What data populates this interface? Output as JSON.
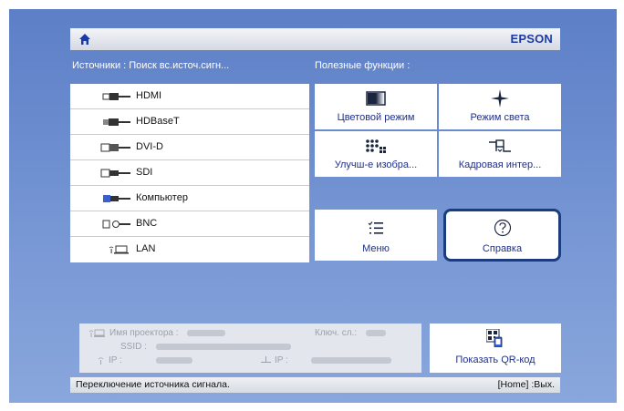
{
  "header": {
    "brand": "EPSON",
    "home_icon": "home-icon"
  },
  "sources": {
    "title": "Источники : Поиск вс.источ.сигн...",
    "items": [
      {
        "label": "HDMI",
        "icon": "hdmi-connector-icon"
      },
      {
        "label": "HDBaseT",
        "icon": "hdbaset-connector-icon"
      },
      {
        "label": "DVI-D",
        "icon": "dvi-connector-icon"
      },
      {
        "label": "SDI",
        "icon": "sdi-connector-icon"
      },
      {
        "label": "Компьютер",
        "icon": "vga-connector-icon"
      },
      {
        "label": "BNC",
        "icon": "bnc-connector-icon"
      },
      {
        "label": "LAN",
        "icon": "lan-icon"
      }
    ]
  },
  "functions": {
    "title": "Полезные функции :",
    "tiles": [
      {
        "label": "Цветовой режим",
        "icon": "color-mode-icon"
      },
      {
        "label": "Режим света",
        "icon": "light-mode-icon"
      },
      {
        "label": "Улучш-е изобра...",
        "icon": "image-enhance-icon"
      },
      {
        "label": "Кадровая интер...",
        "icon": "frame-interpolation-icon"
      },
      {
        "label": "Меню",
        "icon": "menu-list-icon"
      },
      {
        "label": "Справка",
        "icon": "help-icon"
      }
    ]
  },
  "info": {
    "projector_name_label": "Имя проектора :",
    "key_label": "Ключ. сл.:",
    "ssid_label": "SSID :",
    "ip_label_wireless": "IP :",
    "ip_label_wired": "IP :"
  },
  "qr": {
    "label": "Показать QR-код",
    "icon": "qr-code-icon"
  },
  "status": {
    "left": "Переключение источника сигнала.",
    "right": "[Home] :Вых."
  },
  "colors": {
    "background": "#6c8dcf",
    "brand": "#1c3aa6",
    "focus_outline": "#1b3c7e"
  }
}
